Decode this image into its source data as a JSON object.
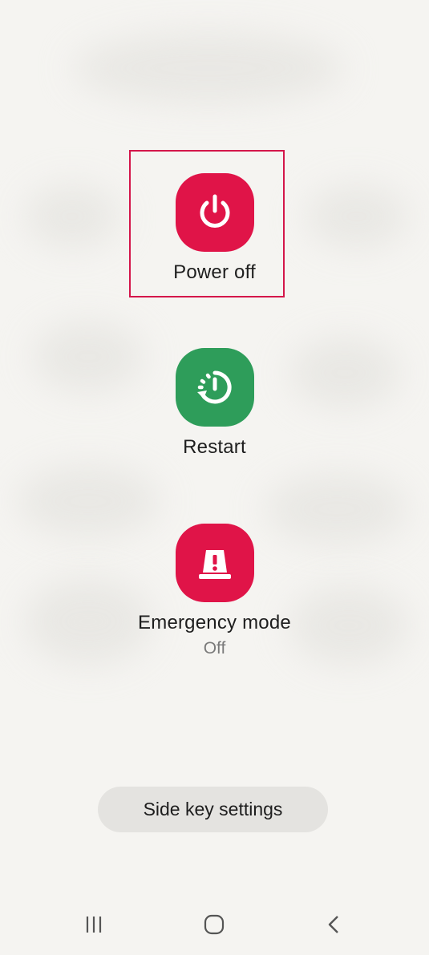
{
  "actions": {
    "power_off": {
      "label": "Power off",
      "icon": "power-icon",
      "color": "#e01448"
    },
    "restart": {
      "label": "Restart",
      "icon": "restart-icon",
      "color": "#2e9d5a"
    },
    "emergency": {
      "label": "Emergency mode",
      "status": "Off",
      "icon": "emergency-light-icon",
      "color": "#e01448"
    }
  },
  "side_key": {
    "label": "Side key settings"
  },
  "navbar": {
    "recents_icon": "recents-icon",
    "home_icon": "home-icon",
    "back_icon": "back-icon"
  },
  "highlight_color": "#d4164a"
}
